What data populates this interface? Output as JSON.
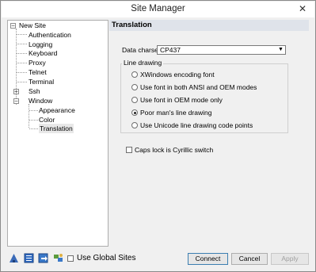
{
  "window": {
    "title": "Site Manager",
    "close_glyph": "✕"
  },
  "tree": {
    "items": [
      {
        "label": "New Site",
        "expander": "−"
      },
      {
        "label": "Authentication"
      },
      {
        "label": "Logging"
      },
      {
        "label": "Keyboard"
      },
      {
        "label": "Proxy"
      },
      {
        "label": "Telnet"
      },
      {
        "label": "Terminal"
      },
      {
        "label": "Ssh",
        "expander": "+"
      },
      {
        "label": "Window",
        "expander": "−"
      },
      {
        "label": "Appearance"
      },
      {
        "label": "Color"
      },
      {
        "label": "Translation"
      }
    ]
  },
  "panel": {
    "title": "Translation",
    "charset_label": "Data charset:",
    "charset_value": "CP437",
    "charset_arrow": "▼",
    "line_drawing": {
      "legend": "Line drawing",
      "options": [
        {
          "label": "XWindows encoding font",
          "checked": false
        },
        {
          "label": "Use font in both ANSI and OEM modes",
          "checked": false
        },
        {
          "label": "Use font in OEM mode only",
          "checked": false
        },
        {
          "label": "Poor man's line drawing",
          "checked": true
        },
        {
          "label": "Use Unicode line drawing code points",
          "checked": false
        }
      ]
    },
    "caps_lock_label": "Caps lock is Cyrillic switch"
  },
  "bottom": {
    "use_global_sites": "Use Global Sites",
    "connect": "Connect",
    "cancel": "Cancel",
    "apply": "Apply"
  },
  "colors": {
    "header_bg": "#dfe3ea",
    "tree_bg": "#ffffff",
    "accent_border": "#3c7fb1"
  }
}
